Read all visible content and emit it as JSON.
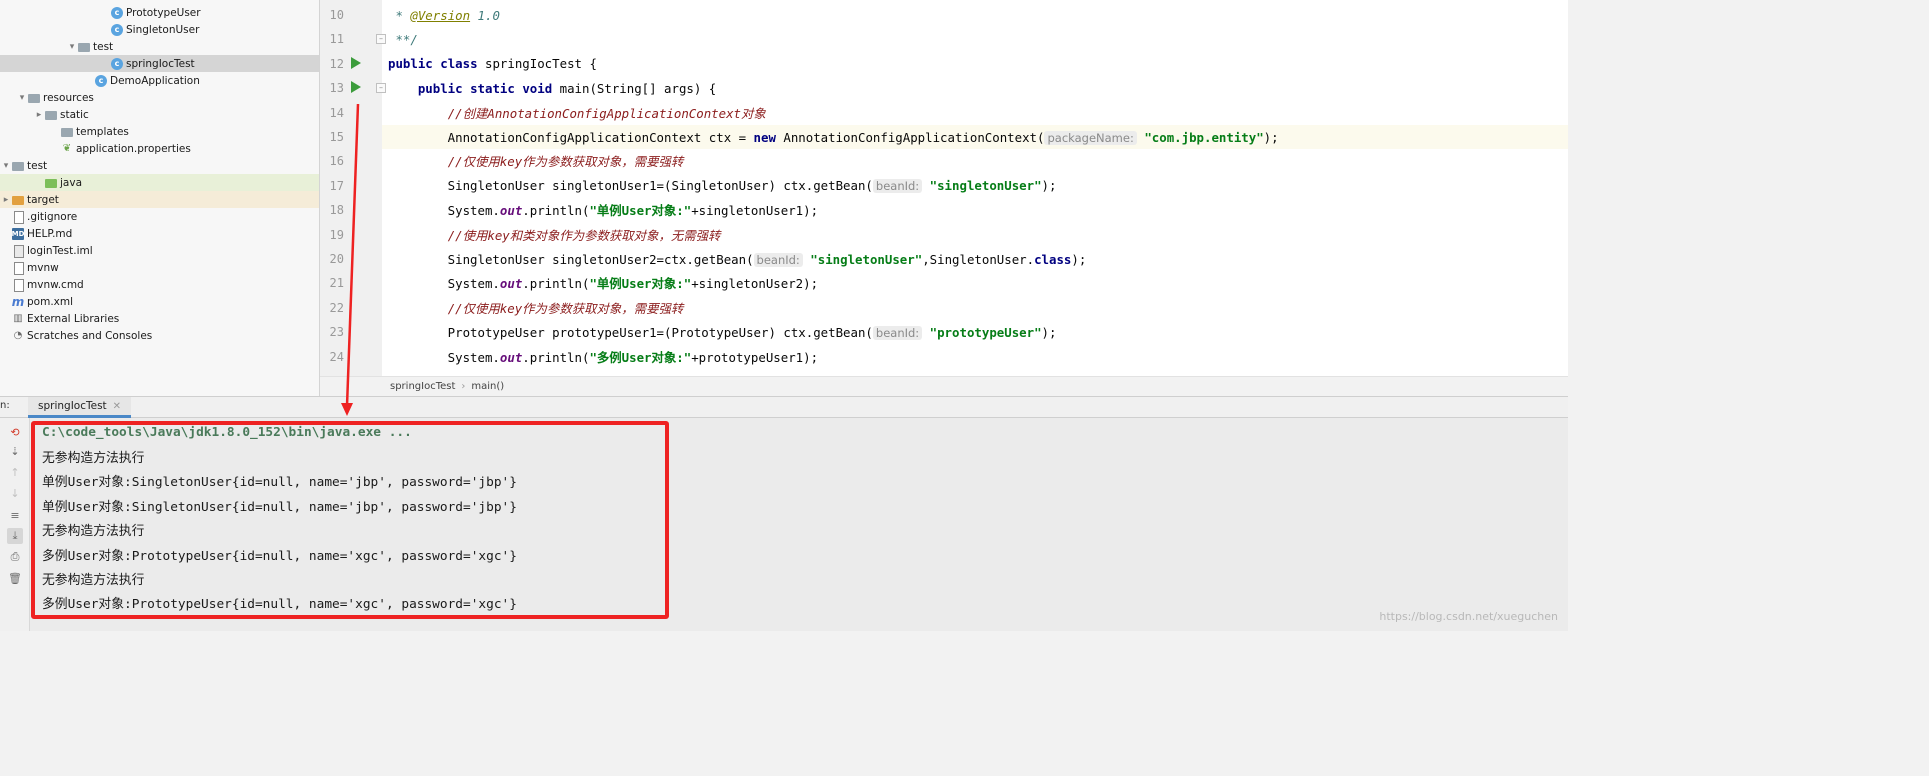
{
  "tree": [
    {
      "label": "PrototypeUser",
      "icon": "class-icon",
      "indent": 113,
      "arrow": ""
    },
    {
      "label": "SingletonUser",
      "icon": "class-icon",
      "indent": 113,
      "arrow": ""
    },
    {
      "label": "test",
      "icon": "folder-icon",
      "indent": 80,
      "arrow": "▾"
    },
    {
      "label": "springIocTest",
      "icon": "class-icon",
      "indent": 113,
      "arrow": "",
      "state": "selected"
    },
    {
      "label": "DemoApplication",
      "icon": "class-icon",
      "indent": 97,
      "arrow": ""
    },
    {
      "label": "resources",
      "icon": "resources-folder-icon",
      "indent": 30,
      "arrow": "▾"
    },
    {
      "label": "static",
      "icon": "folder-icon",
      "indent": 47,
      "arrow": "▸"
    },
    {
      "label": "templates",
      "icon": "folder-icon",
      "indent": 63,
      "arrow": ""
    },
    {
      "label": "application.properties",
      "icon": "properties-leaf-icon",
      "indent": 63,
      "arrow": ""
    },
    {
      "label": "test",
      "icon": "folder-icon",
      "indent": 14,
      "arrow": "▾"
    },
    {
      "label": "java",
      "icon": "test-folder-icon",
      "indent": 47,
      "arrow": "",
      "state": "highlight"
    },
    {
      "label": "target",
      "icon": "excluded-folder-icon",
      "indent": 0,
      "arrow": "▸",
      "state": "highlight-orange"
    },
    {
      "label": ".gitignore",
      "icon": "file-icon",
      "indent": 14,
      "arrow": ""
    },
    {
      "label": "HELP.md",
      "icon": "markdown-icon",
      "indent": 14,
      "arrow": ""
    },
    {
      "label": "loginTest.iml",
      "icon": "iml-file-icon",
      "indent": 14,
      "arrow": ""
    },
    {
      "label": "mvnw",
      "icon": "file-icon",
      "indent": 14,
      "arrow": ""
    },
    {
      "label": "mvnw.cmd",
      "icon": "file-icon",
      "indent": 14,
      "arrow": ""
    },
    {
      "label": "pom.xml",
      "icon": "maven-icon",
      "indent": 14,
      "arrow": ""
    },
    {
      "label": "External Libraries",
      "icon": "libraries-icon",
      "indent": 0,
      "arrow": ""
    },
    {
      "label": "Scratches and Consoles",
      "icon": "scratches-icon",
      "indent": 0,
      "arrow": ""
    }
  ],
  "editor": {
    "line_numbers": [
      "10",
      "11",
      "12",
      "13",
      "14",
      "15",
      "16",
      "17",
      "18",
      "19",
      "20",
      "21",
      "22",
      "23",
      "24"
    ],
    "lines": [
      [
        {
          "t": " * ",
          "c": "jd"
        },
        {
          "t": "@Version",
          "c": "ann"
        },
        {
          "t": " 1.0",
          "c": "jd"
        }
      ],
      [
        {
          "t": " **/",
          "c": "jd"
        }
      ],
      [
        {
          "t": "public",
          "c": "kw"
        },
        {
          "t": " "
        },
        {
          "t": "class",
          "c": "kw"
        },
        {
          "t": " springIocTest {"
        }
      ],
      [
        {
          "t": "    "
        },
        {
          "t": "public",
          "c": "kw"
        },
        {
          "t": " "
        },
        {
          "t": "static",
          "c": "kw"
        },
        {
          "t": " "
        },
        {
          "t": "void",
          "c": "kw"
        },
        {
          "t": " main(String[] args) {"
        }
      ],
      [
        {
          "t": "        "
        },
        {
          "t": "//创建AnnotationConfigApplicationContext对象",
          "c": "cm"
        }
      ],
      [
        {
          "t": "        AnnotationConfigApplicationContext ctx = "
        },
        {
          "t": "new",
          "c": "kw"
        },
        {
          "t": " AnnotationConfigApplicationContext("
        },
        {
          "t": "packageName:",
          "c": "hint"
        },
        {
          "t": " "
        },
        {
          "t": "\"com.jbp.entity\"",
          "c": "str"
        },
        {
          "t": ");"
        }
      ],
      [
        {
          "t": "        "
        },
        {
          "t": "//仅使用key作为参数获取对象，需要强转",
          "c": "cm"
        }
      ],
      [
        {
          "t": "        SingletonUser singletonUser1=(SingletonUser) ctx.getBean("
        },
        {
          "t": "beanId:",
          "c": "hint"
        },
        {
          "t": " "
        },
        {
          "t": "\"singletonUser\"",
          "c": "str"
        },
        {
          "t": ");"
        }
      ],
      [
        {
          "t": "        System."
        },
        {
          "t": "out",
          "c": "fld"
        },
        {
          "t": ".println("
        },
        {
          "t": "\"单例User对象:\"",
          "c": "str"
        },
        {
          "t": "+singletonUser1);"
        }
      ],
      [
        {
          "t": "        "
        },
        {
          "t": "//使用key和类对象作为参数获取对象，无需强转",
          "c": "cm"
        }
      ],
      [
        {
          "t": "        SingletonUser singletonUser2=ctx.getBean("
        },
        {
          "t": "beanId:",
          "c": "hint"
        },
        {
          "t": " "
        },
        {
          "t": "\"singletonUser\"",
          "c": "str"
        },
        {
          "t": ",SingletonUser."
        },
        {
          "t": "class",
          "c": "kw"
        },
        {
          "t": ");"
        }
      ],
      [
        {
          "t": "        System."
        },
        {
          "t": "out",
          "c": "fld"
        },
        {
          "t": ".println("
        },
        {
          "t": "\"单例User对象:\"",
          "c": "str"
        },
        {
          "t": "+singletonUser2);"
        }
      ],
      [
        {
          "t": "        "
        },
        {
          "t": "//仅使用key作为参数获取对象，需要强转",
          "c": "cm"
        }
      ],
      [
        {
          "t": "        PrototypeUser prototypeUser1=(PrototypeUser) ctx.getBean("
        },
        {
          "t": "beanId:",
          "c": "hint"
        },
        {
          "t": " "
        },
        {
          "t": "\"prototypeUser\"",
          "c": "str"
        },
        {
          "t": ");"
        }
      ],
      [
        {
          "t": "        System."
        },
        {
          "t": "out",
          "c": "fld"
        },
        {
          "t": ".println("
        },
        {
          "t": "\"多例User对象:\"",
          "c": "str"
        },
        {
          "t": "+prototypeUser1);"
        }
      ]
    ],
    "current_line_index": 5,
    "run_marker_lines": [
      2,
      3
    ],
    "fold_marker_lines": [
      1,
      3
    ]
  },
  "breadcrumb": {
    "class_name": "springIocTest",
    "method_name": "main()"
  },
  "run_panel": {
    "label": "n:",
    "tab_label": "springIocTest",
    "output": [
      {
        "text": "C:\\code_tools\\Java\\jdk1.8.0_152\\bin\\java.exe ...",
        "kind": "cmd"
      },
      {
        "text": "无参构造方法执行",
        "kind": "out"
      },
      {
        "text": "单例User对象:SingletonUser{id=null, name='jbp', password='jbp'}",
        "kind": "out"
      },
      {
        "text": "单例User对象:SingletonUser{id=null, name='jbp', password='jbp'}",
        "kind": "out"
      },
      {
        "text": "无参构造方法执行",
        "kind": "out"
      },
      {
        "text": "多例User对象:PrototypeUser{id=null, name='xgc', password='xgc'}",
        "kind": "out"
      },
      {
        "text": "无参构造方法执行",
        "kind": "out"
      },
      {
        "text": "多例User对象:PrototypeUser{id=null, name='xgc', password='xgc'}",
        "kind": "out"
      }
    ]
  },
  "watermark": "https://blog.csdn.net/xueguchen",
  "colors": {
    "annotation_red": "#ee2222",
    "run_green": "#3c9c3c",
    "keyword": "#000080",
    "string": "#067d17",
    "comment": "#8b1c1c"
  }
}
